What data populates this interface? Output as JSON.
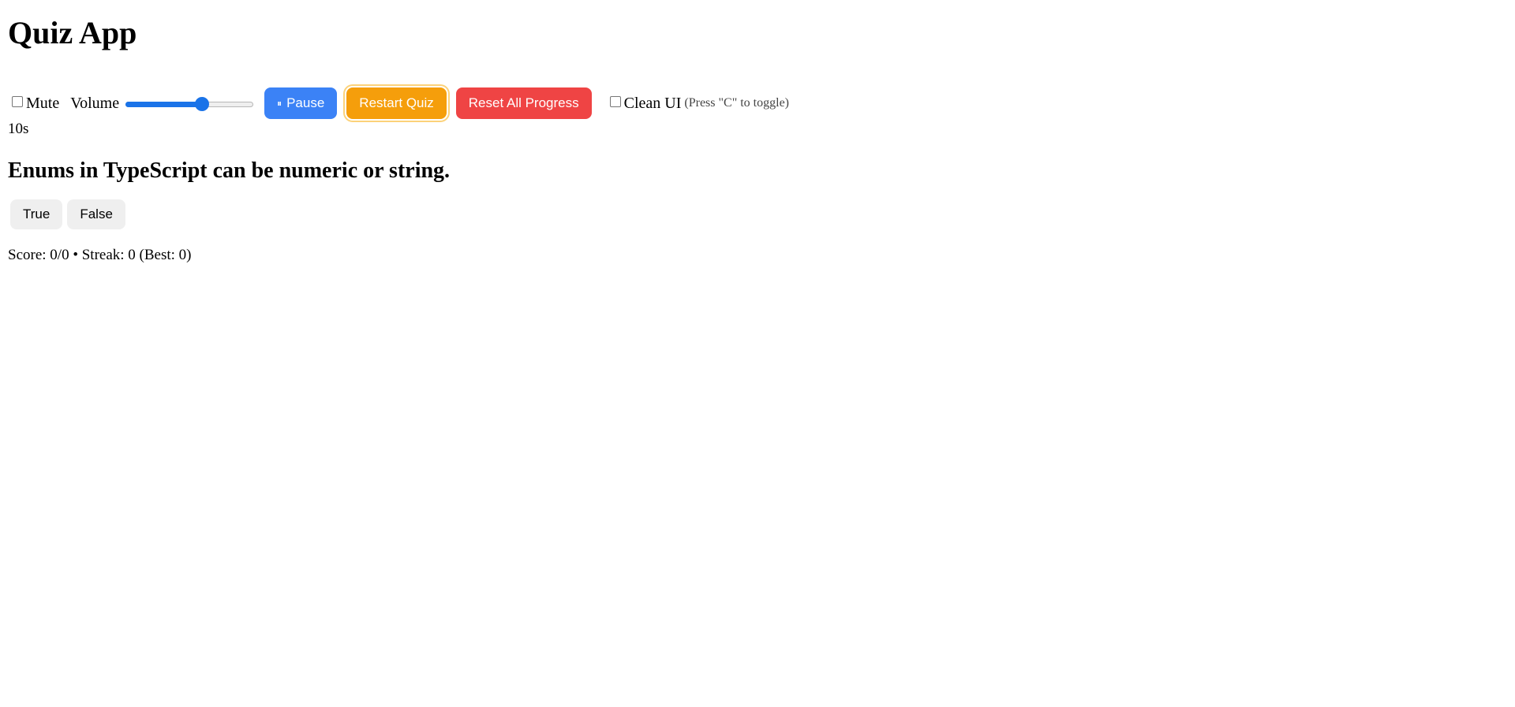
{
  "app": {
    "title": "Quiz App"
  },
  "controls": {
    "mute_label": "Mute",
    "mute_checked": false,
    "volume_label": "Volume",
    "volume_level": 0.6,
    "pause_icon": "pause-icon",
    "pause_glyph": "⏸",
    "pause_label": "Pause",
    "restart_label": "Restart Quiz",
    "reset_label": "Reset All Progress",
    "clean_ui_label": "Clean UI",
    "clean_ui_checked": false,
    "clean_ui_hint": "(Press \"C\" to toggle)"
  },
  "colors": {
    "pause": "#3b82f6",
    "restart": "#f59e0b",
    "reset": "#ef4444",
    "slider_accent": "#1a73e8"
  },
  "timer": {
    "text": "10s"
  },
  "question": {
    "text": "Enums in TypeScript can be numeric or string.",
    "answers": [
      "True",
      "False"
    ]
  },
  "status": {
    "text": "Score: 0/0 • Streak: 0 (Best: 0)"
  }
}
